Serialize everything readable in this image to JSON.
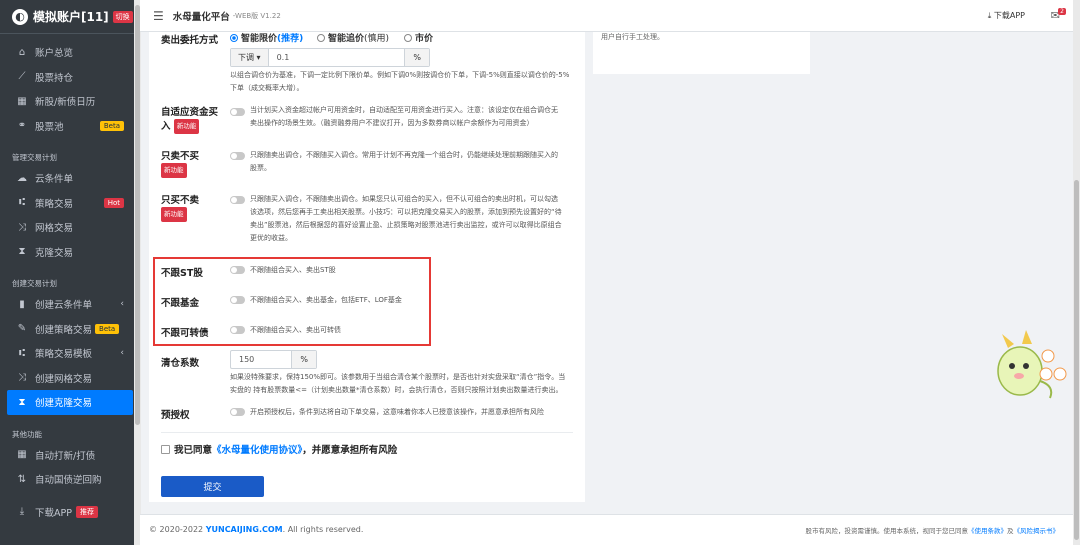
{
  "sidebar": {
    "brand": {
      "title": "模拟账户[11]",
      "badge": "切换"
    },
    "items": [
      {
        "icon": "home-icon",
        "glyph": "⌂",
        "label": "账户总览"
      },
      {
        "icon": "chart-icon",
        "glyph": "📈",
        "label": "股票持仓"
      },
      {
        "icon": "calendar-icon",
        "glyph": "▦",
        "label": "新股/新债日历"
      },
      {
        "icon": "pool-icon",
        "glyph": "⚭",
        "label": "股票池",
        "badge": "Beta"
      }
    ],
    "section1": "管理交易计划",
    "manage_items": [
      {
        "icon": "cloud-icon",
        "glyph": "☁",
        "label": "云条件单"
      },
      {
        "icon": "strategy-icon",
        "glyph": "⑆",
        "label": "策略交易",
        "badge": "Hot"
      },
      {
        "icon": "grid-icon",
        "glyph": "⤨",
        "label": "网格交易"
      },
      {
        "icon": "hourglass-icon",
        "glyph": "⧗",
        "label": "克隆交易"
      }
    ],
    "section2": "创建交易计划",
    "create_items": [
      {
        "icon": "file-icon",
        "glyph": "▮",
        "label": "创建云条件单",
        "chevron": "‹"
      },
      {
        "icon": "magic-icon",
        "glyph": "✎",
        "label": "创建策略交易",
        "badge": "Beta"
      },
      {
        "icon": "template-icon",
        "glyph": "⑆",
        "label": "策略交易模板",
        "chevron": "‹"
      },
      {
        "icon": "grid-icon",
        "glyph": "⤨",
        "label": "创建网格交易"
      },
      {
        "icon": "hourglass-icon",
        "glyph": "⧗",
        "label": "创建克隆交易",
        "active": true
      }
    ],
    "section3": "其他功能",
    "other_items": [
      {
        "icon": "calendar-icon",
        "glyph": "▦",
        "label": "自动打新/打债"
      },
      {
        "icon": "sort-icon",
        "glyph": "⇅",
        "label": "自动国债逆回购"
      }
    ],
    "download": {
      "label": "下载APP",
      "badge": "推荐"
    }
  },
  "topbar": {
    "title": "水母量化平台",
    "version": "-WEB版 V1.22",
    "download": "下载APP",
    "mail_count": "2"
  },
  "form": {
    "sell_method": {
      "label": "卖出委托方式",
      "option1": "智能限价",
      "option1_tag": "(推荐)",
      "option2": "智能追价",
      "option2_tag": "(慎用)",
      "option3": "市价"
    },
    "adjust": {
      "select": "下调",
      "value": "0.1",
      "unit": "%",
      "desc1": "以组合调仓价为基准，下调一定比例下限价单。例如下调0%则按调仓价下单，下调-5%则直接以调仓价的-5%",
      "desc2": "下单（成交概率大增）。"
    },
    "adaptive": {
      "label1": "自适应资金买",
      "label2": "入",
      "tag": "新功能",
      "desc1": "当计划买入资金超过帐户可用资金时，自动适配至可用资金进行买入。注意：该设定仅在组合调仓无",
      "desc2": "卖出操作的场景生效。（融资融券用户不建议打开，因为多数券商以帐户余额作为可用资金）"
    },
    "sell_only": {
      "label": "只卖不买",
      "tag": "新功能",
      "desc1": "只跟随卖出调仓，不跟随买入调仓。常用于计划不再克隆一个组合时，仍能继续处理前期跟随买入的",
      "desc2": "股票。"
    },
    "buy_only": {
      "label": "只买不卖",
      "tag": "新功能",
      "desc1": "只跟随买入调仓，不跟随卖出调仓。如果您只认可组合的买入，但不认可组合的卖出时机，可以勾选",
      "desc2": "该选项，然后您再手工卖出相关股票。小技巧：可以把克隆交易买入的股票，添加到预先设置好的“待",
      "desc3": "卖出”股票池，然后根据您的喜好设置止盈、止损策略对股票池进行卖出监控，或许可以取得比原组合",
      "desc4": "更优的收益。"
    },
    "no_st": {
      "label": "不跟ST股",
      "desc": "不跟随组合买入、卖出ST股"
    },
    "no_fund": {
      "label": "不跟基金",
      "desc": "不跟随组合买入、卖出基金，包括ETF、LOF基金"
    },
    "no_bond": {
      "label": "不跟可转债",
      "desc": "不跟随组合买入、卖出可转债"
    },
    "clear": {
      "label": "清仓系数",
      "value": "150",
      "unit": "%",
      "desc1": "如果没特殊要求，保持150%即可。该参数用于当组合清仓某个股票时，是否也针对实盘采取“清仓”指令。当",
      "desc2": "实盘的 持有股票数量<=（计划卖出数量*清仓系数）时，会执行清仓，否则只按照计划卖出数量进行卖出。"
    },
    "pre_auth": {
      "label": "预授权",
      "desc": "开启预授权后，条件到达将自动下单交易，这意味着你本人已授意该操作，并愿意承担所有风险"
    },
    "agree": {
      "prefix": "我已同意",
      "link": "《水母量化使用协议》",
      "suffix": "，并愿意承担所有风险"
    },
    "submit": "提交"
  },
  "right_card": {
    "text": "用户自行手工处理。"
  },
  "footer": {
    "copyright_prefix": "© 2020-2022 ",
    "copyright_brand": "YUNCAIJING.COM",
    "copyright_suffix": ". All rights reserved.",
    "risk_prefix": "股市有风险，投资需谨慎。使用本系统，视同于您已同意",
    "terms": "《使用条款》",
    "and": "及",
    "risk_link": "《风险揭示书》"
  }
}
